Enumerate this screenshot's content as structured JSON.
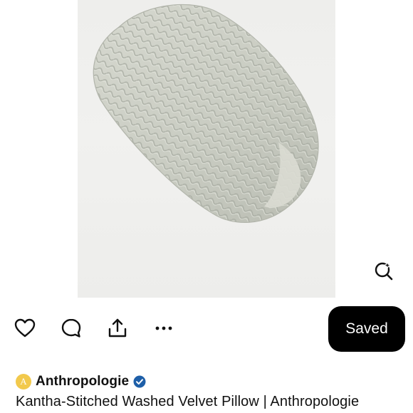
{
  "pin": {
    "image_alt": "Kantha-Stitched Washed Velvet Pillow",
    "saved_label": "Saved",
    "source_name": "Anthropologie",
    "source_initial": "A",
    "title": "Kantha-Stitched Washed Velvet Pillow | Anthropologie"
  },
  "icons": {
    "visual_search": "visual-search-icon",
    "like": "heart-icon",
    "comment": "comment-icon",
    "share": "share-icon",
    "more": "more-icon",
    "verified": "verified-badge-icon"
  },
  "colors": {
    "saved_button_bg": "#000000",
    "verified_badge": "#1e5fa8",
    "avatar_bg": "#f2c94c"
  }
}
